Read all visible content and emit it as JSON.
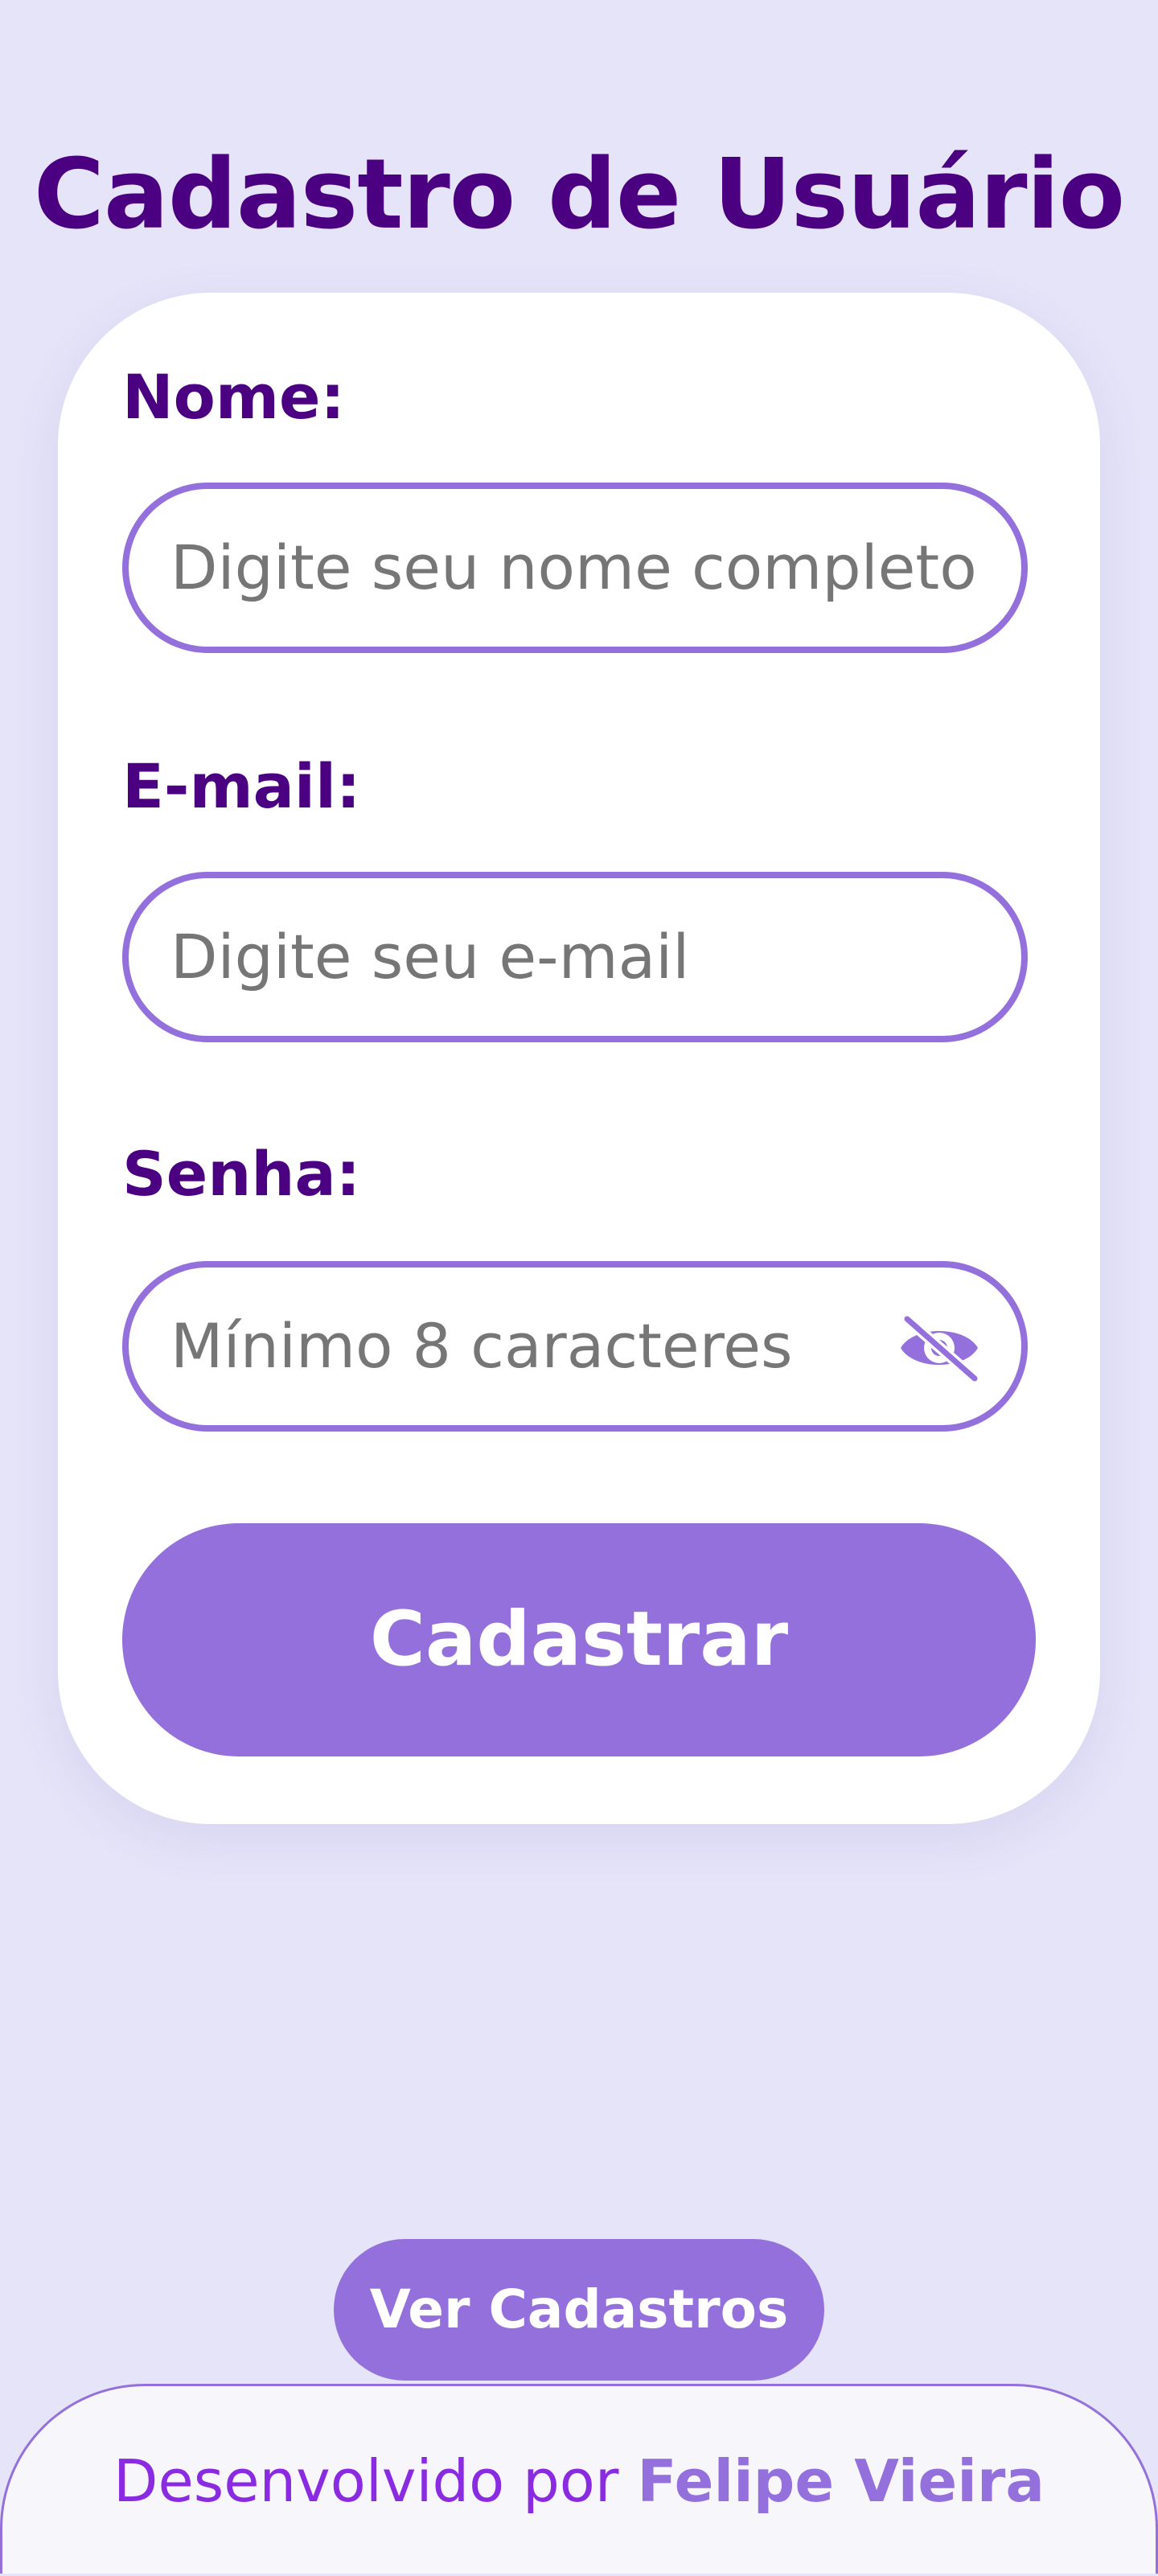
{
  "page": {
    "title": "Cadastro de Usuário"
  },
  "form": {
    "name": {
      "label": "Nome:",
      "placeholder": "Digite seu nome completo",
      "value": ""
    },
    "email": {
      "label": "E-mail:",
      "placeholder": "Digite seu e-mail",
      "value": ""
    },
    "password": {
      "label": "Senha:",
      "placeholder": "Mínimo 8 caracteres",
      "value": "",
      "toggle_icon": "eye-slash-icon"
    },
    "submit_label": "Cadastrar"
  },
  "actions": {
    "view_label": "Ver Cadastros"
  },
  "footer": {
    "prefix": "Desenvolvido por",
    "author": "Felipe Vieira"
  },
  "colors": {
    "background": "#e5e4f8",
    "title": "#4b0082",
    "accent": "#9370db",
    "placeholder": "#767676",
    "footer_text": "#8a2be2",
    "card": "#ffffff"
  }
}
